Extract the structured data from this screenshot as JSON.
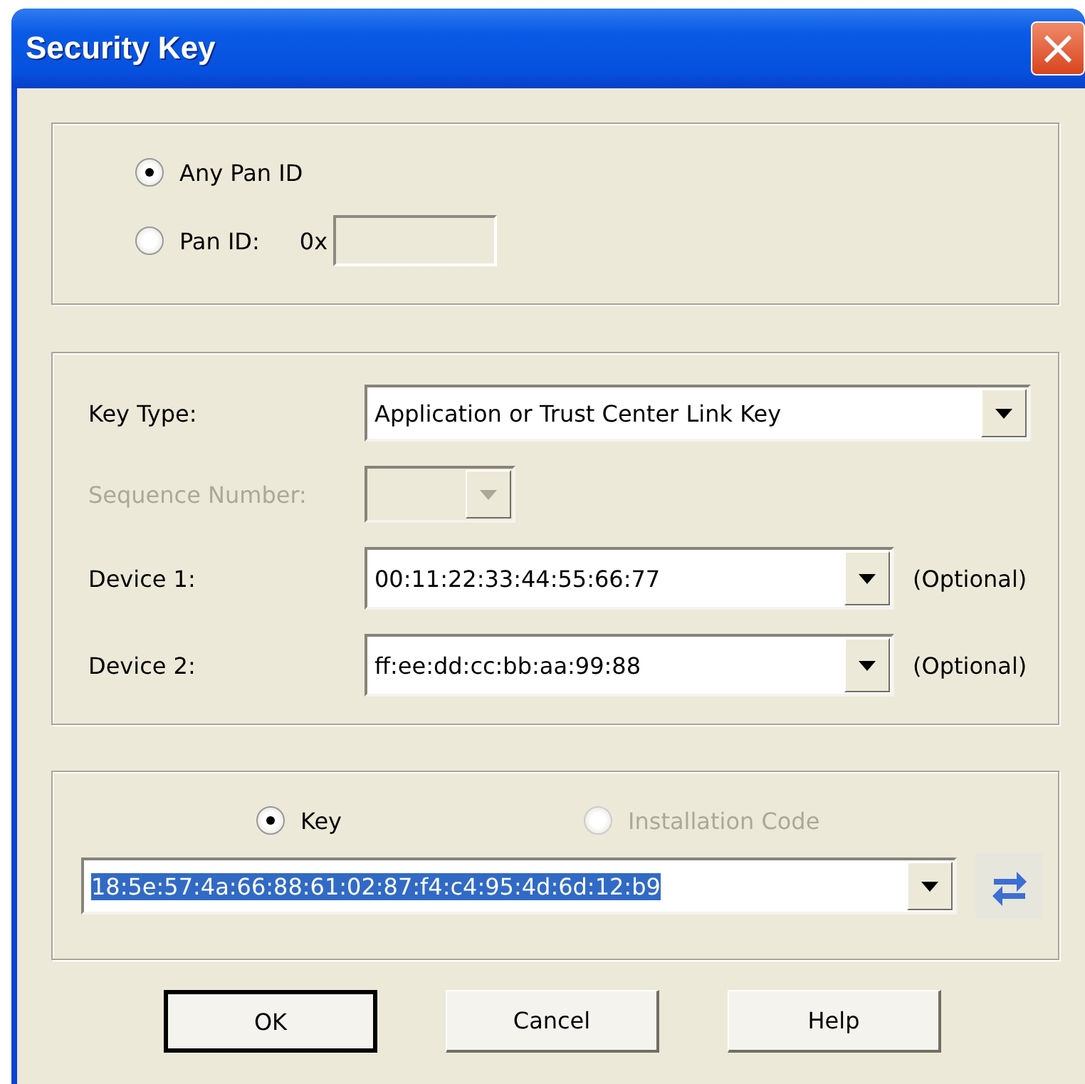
{
  "window": {
    "title": "Security Key",
    "close": "×"
  },
  "pan": {
    "options": [
      {
        "label": "Any Pan ID",
        "selected": true
      },
      {
        "label": "Pan ID:",
        "selected": false
      }
    ],
    "prefix": "0x"
  },
  "fields": [
    {
      "label": "Key Type:",
      "value": "Application or Trust Center Link Key",
      "disabled": false,
      "kind": "wide"
    },
    {
      "label": "Sequence Number:",
      "disabled": true,
      "kind": "small"
    },
    {
      "label": "Device 1:",
      "value": "00:11:22:33:44:55:66:77",
      "disabled": false,
      "kind": "device",
      "note": "(Optional)"
    },
    {
      "label": "Device 2:",
      "value": "ff:ee:dd:cc:bb:aa:99:88",
      "disabled": false,
      "kind": "device",
      "note": "(Optional)"
    }
  ],
  "key": {
    "options": [
      {
        "label": "Key",
        "selected": true,
        "disabled": false
      },
      {
        "label": "Installation Code",
        "selected": false,
        "disabled": true
      }
    ],
    "value": "18:5e:57:4a:66:88:61:02:87:f4:c4:95:4d:6d:12:b9",
    "value_selected": true
  },
  "buttons": [
    {
      "label": "OK",
      "default": true
    },
    {
      "label": "Cancel",
      "default": false
    },
    {
      "label": "Help",
      "default": false
    }
  ]
}
